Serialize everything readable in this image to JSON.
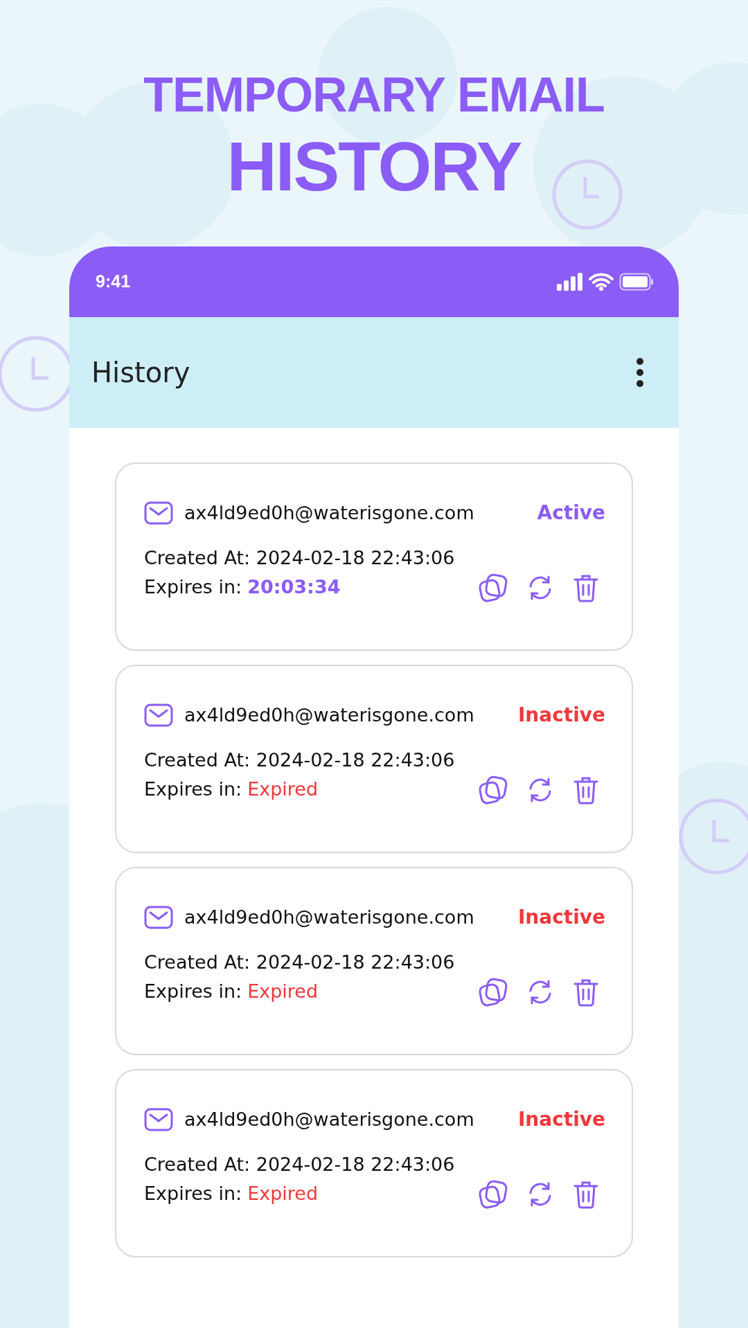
{
  "headline": {
    "line_1": "TEMPORARY EMAIL",
    "line_2": "HISTORY"
  },
  "status_bar": {
    "time": "9:41"
  },
  "app_bar": {
    "title": "History"
  },
  "cards": [
    {
      "email": "ax4ld9ed0h@waterisgone.com",
      "status": "Active",
      "kind": "active",
      "created": "Created At: 2024-02-18 22:43:06",
      "expires_label": "Expires in:",
      "expires_value": "20:03:34"
    },
    {
      "email": "ax4ld9ed0h@waterisgone.com",
      "status": "Inactive",
      "kind": "inactive",
      "created": "Created At: 2024-02-18 22:43:06",
      "expires_label": "Expires in:",
      "expires_value": "Expired"
    },
    {
      "email": "ax4ld9ed0h@waterisgone.com",
      "status": "Inactive",
      "kind": "inactive",
      "created": "Created At: 2024-02-18 22:43:06",
      "expires_label": "Expires in:",
      "expires_value": "Expired"
    },
    {
      "email": "ax4ld9ed0h@waterisgone.com",
      "status": "Inactive",
      "kind": "inactive",
      "created": "Created At: 2024-02-18 22:43:06",
      "expires_label": "Expires in:",
      "expires_value": "Expired"
    }
  ]
}
